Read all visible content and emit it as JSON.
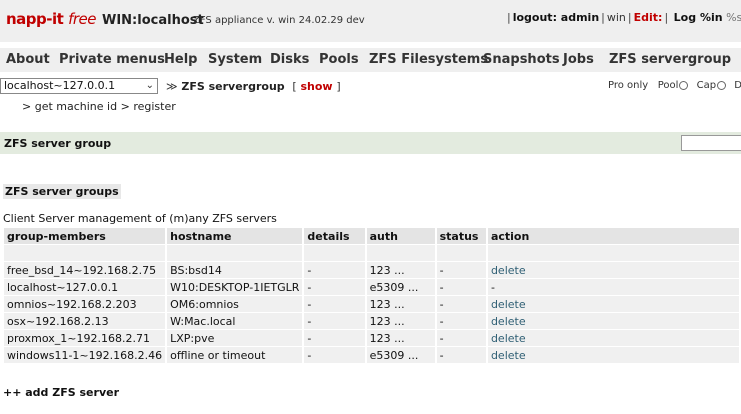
{
  "header": {
    "logo_main": "napp-it",
    "logo_free": "free",
    "host": "WIN:localhost",
    "appliance": "ZFS appliance v. win 24.02.29 dev",
    "logout": "logout: admin",
    "win": "win",
    "edit": "Edit:",
    "log": "Log %in",
    "sys": "%sys"
  },
  "menu": [
    "About",
    "Private menus",
    "Help",
    "System",
    "Disks",
    "Pools",
    "ZFS Filesystems",
    "Snapshots",
    "Jobs",
    "ZFS servergroup"
  ],
  "server_select": "localhost~127.0.0.1",
  "breadcrumb": {
    "arrow": "≫",
    "current": "ZFS servergroup",
    "open": "[",
    "show": "show",
    "close": "]"
  },
  "prefs": [
    "Pro only",
    "Pool",
    "Cap",
    "D"
  ],
  "submenu": [
    ">",
    "get machine id",
    ">",
    "register"
  ],
  "panel_title": "ZFS server group",
  "section_title": "ZFS server groups",
  "description": "Client Server management of (m)any ZFS servers",
  "table": {
    "headers": [
      "group-members",
      "hostname",
      "details",
      "auth",
      "status",
      "action"
    ],
    "rows": [
      [
        "",
        "",
        "",
        "",
        "",
        ""
      ],
      [
        "free_bsd_14~192.168.2.75",
        "BS:bsd14",
        "-",
        "123 ...",
        "-",
        "delete"
      ],
      [
        "localhost~127.0.0.1",
        "W10:DESKTOP-1IETGLR",
        "-",
        "e5309 ...",
        "-",
        "-"
      ],
      [
        "omnios~192.168.2.203",
        "OM6:omnios",
        "-",
        "123 ...",
        "-",
        "delete"
      ],
      [
        "osx~192.168.2.13",
        "W:Mac.local",
        "-",
        "123 ...",
        "-",
        "delete"
      ],
      [
        "proxmox_1~192.168.2.71",
        "LXP:pve",
        "-",
        "123 ...",
        "-",
        "delete"
      ],
      [
        "windows11-1~192.168.2.46",
        "offline or timeout",
        "-",
        "e5309 ...",
        "-",
        "delete"
      ]
    ]
  },
  "add_label": "++ add ZFS server"
}
